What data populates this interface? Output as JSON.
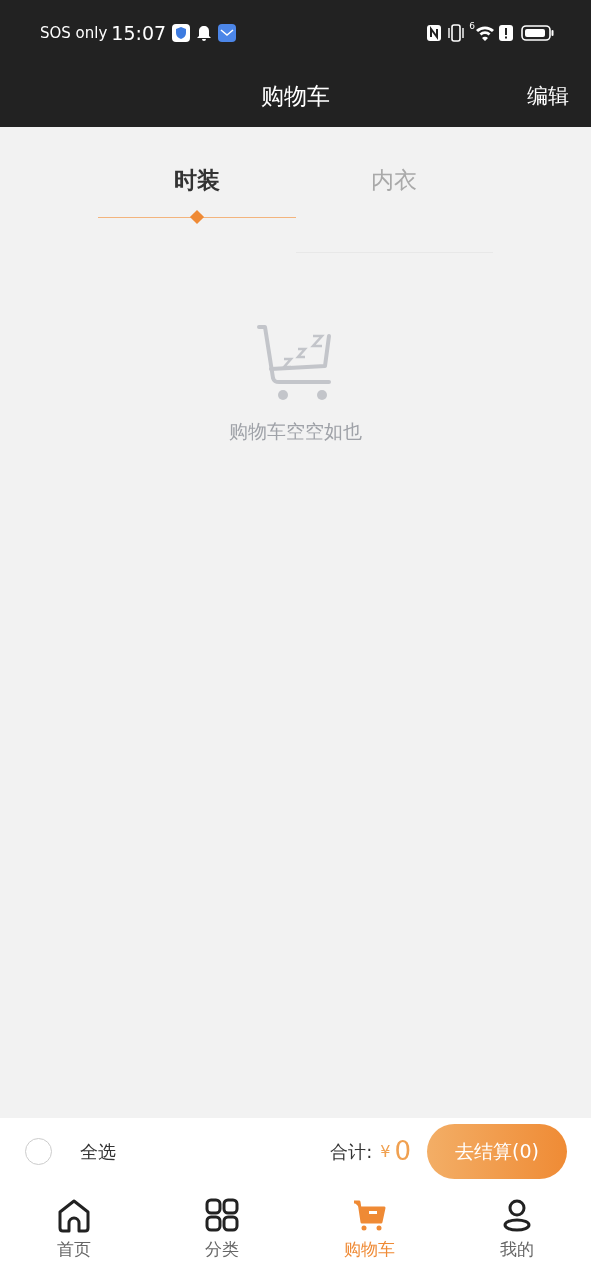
{
  "status_bar": {
    "carrier": "SOS only",
    "time": "15:07",
    "wifi_generation": "6"
  },
  "header": {
    "title": "购物车",
    "action": "编辑"
  },
  "tabs": [
    {
      "label": "时装",
      "selected": true
    },
    {
      "label": "内衣",
      "selected": false
    }
  ],
  "empty_state": {
    "message": "购物车空空如也"
  },
  "footer": {
    "select_all": {
      "label": "全选",
      "checked": false
    },
    "total_label": "合计:",
    "currency": "¥",
    "total": "0",
    "checkout": "去结算(0)"
  },
  "nav": [
    {
      "label": "首页",
      "selected": false
    },
    {
      "label": "分类",
      "selected": false
    },
    {
      "label": "购物车",
      "selected": true
    },
    {
      "label": "我的",
      "selected": false
    }
  ]
}
